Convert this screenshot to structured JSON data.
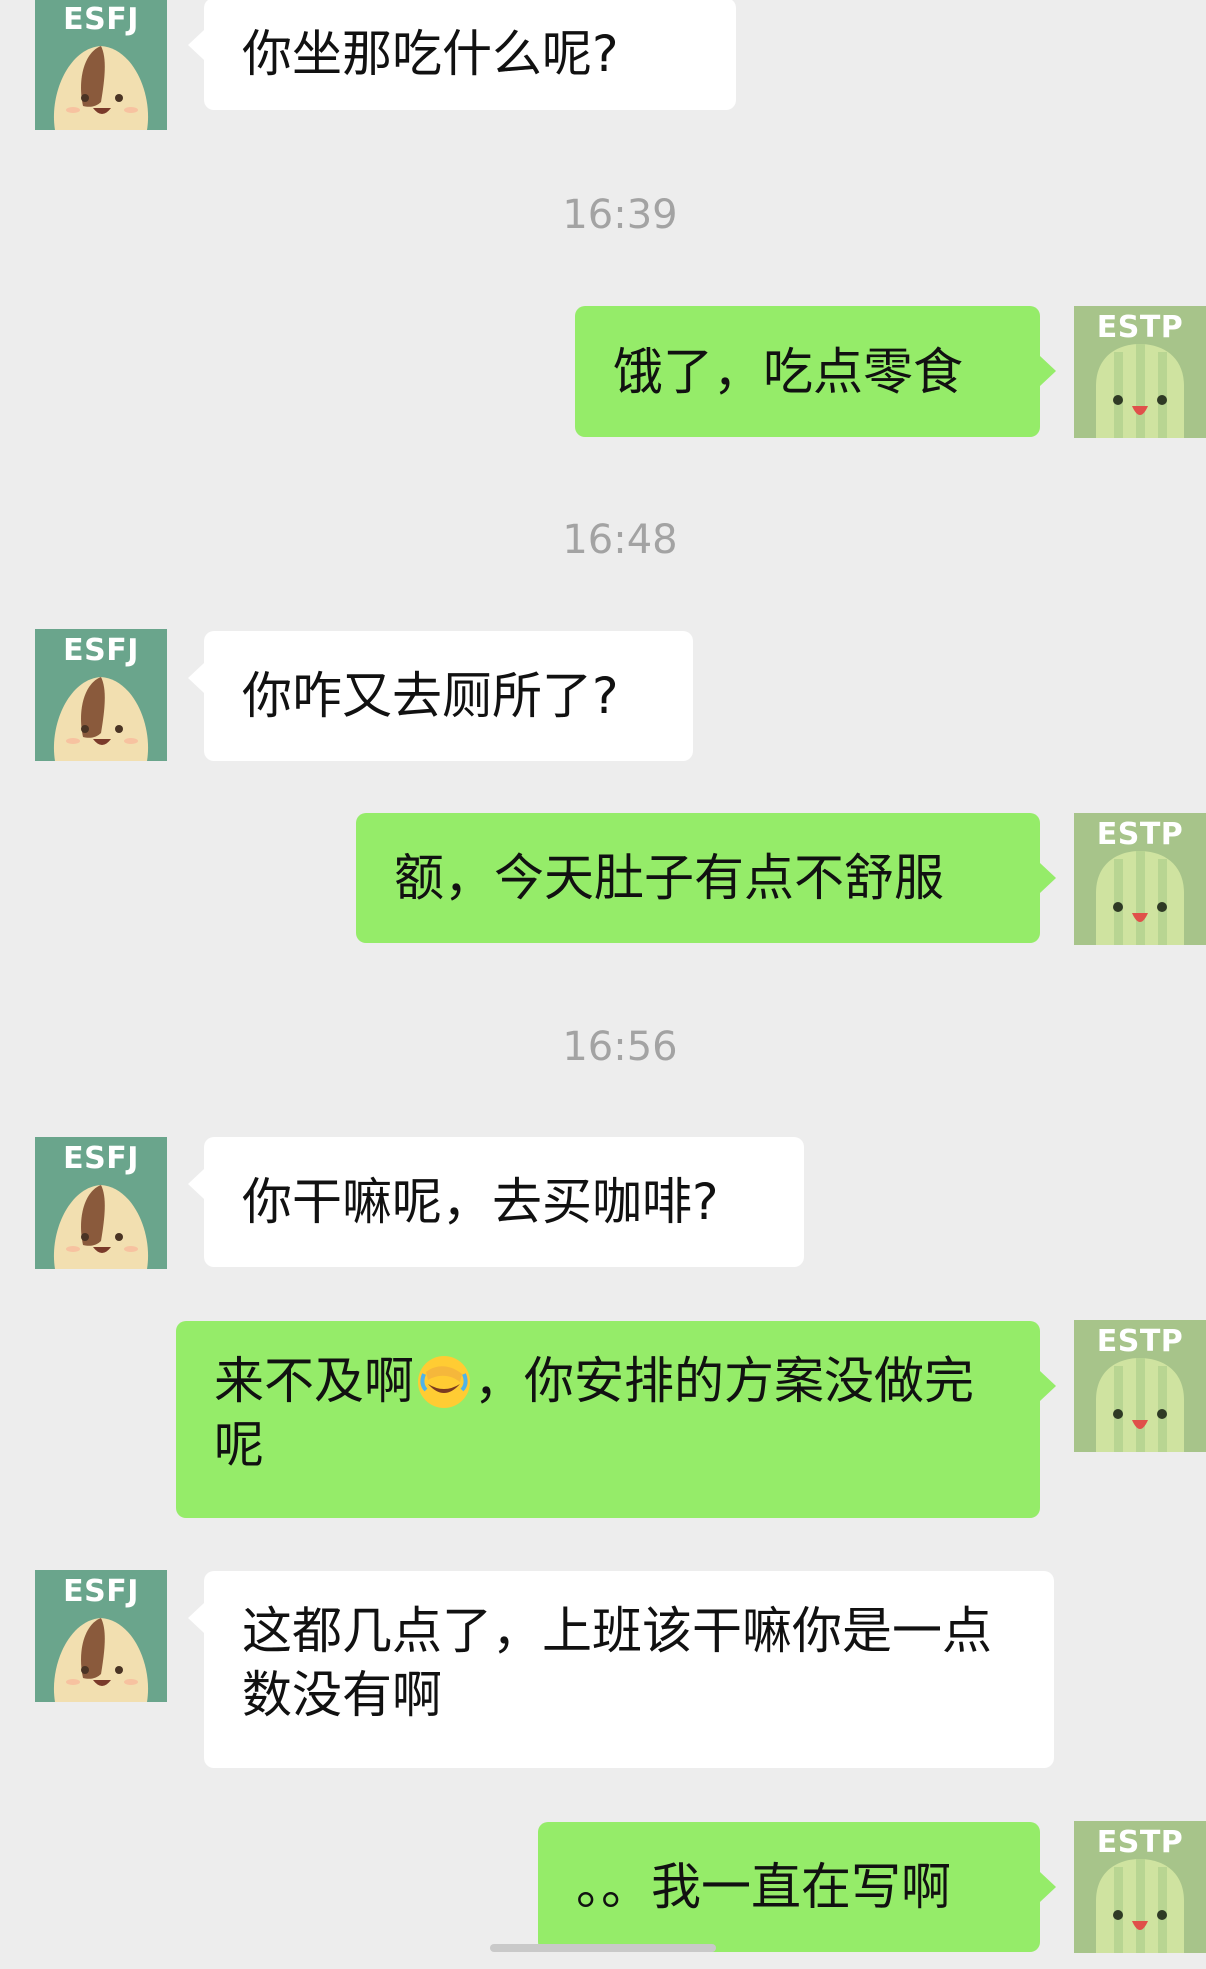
{
  "avatars": {
    "left_tag": "ESFJ",
    "right_tag": "ESTP",
    "left_colors": {
      "bg": "#6aa58c",
      "char": "#f2dfb0",
      "cap": "#8a5a3c"
    },
    "right_colors": {
      "bg": "#a7c48a",
      "char": "#cfe3a0",
      "stripe": "#b8d592"
    }
  },
  "colors": {
    "background": "#ededed",
    "incoming_bubble": "#ffffff",
    "outgoing_bubble": "#95ec69",
    "timestamp": "#a3a3a3",
    "text": "#111111"
  },
  "messages": [
    {
      "id": "m1",
      "side": "left",
      "sender": "ESFJ",
      "text": "你坐那吃什么呢?"
    },
    {
      "id": "t1",
      "type": "timestamp",
      "text": "16:39"
    },
    {
      "id": "m2",
      "side": "right",
      "sender": "ESTP",
      "text": "饿了，吃点零食"
    },
    {
      "id": "t2",
      "type": "timestamp",
      "text": "16:48"
    },
    {
      "id": "m3",
      "side": "left",
      "sender": "ESFJ",
      "text": "你咋又去厕所了?"
    },
    {
      "id": "m4",
      "side": "right",
      "sender": "ESTP",
      "text": "额，今天肚子有点不舒服"
    },
    {
      "id": "t3",
      "type": "timestamp",
      "text": "16:56"
    },
    {
      "id": "m5",
      "side": "left",
      "sender": "ESFJ",
      "text": "你干嘛呢，去买咖啡?"
    },
    {
      "id": "m6",
      "side": "right",
      "sender": "ESTP",
      "text_before_emoji": "来不及啊",
      "emoji": "facepalm-laughing-emoji",
      "text_after_emoji": "，你安排的方案没做完呢"
    },
    {
      "id": "m7",
      "side": "left",
      "sender": "ESFJ",
      "text": "这都几点了，上班该干嘛你是一点数没有啊"
    },
    {
      "id": "m8",
      "side": "right",
      "sender": "ESTP",
      "text": "。。我一直在写啊"
    }
  ]
}
